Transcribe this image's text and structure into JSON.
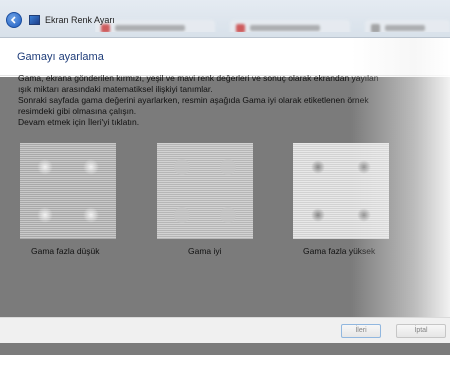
{
  "window": {
    "title": "Ekran Renk Ayarı"
  },
  "page": {
    "title": "Gamayı ayarlama",
    "paragraphs": [
      "Gama, ekrana gönderilen kırmızı, yeşil ve mavi renk değerleri ve sonuç olarak ekrandan yayılan",
      "ışık miktarı arasındaki matematiksel ilişkiyi tanımlar.",
      "Sonraki sayfada gama değerini ayarlarken, resmin aşağıda Gama iyi olarak etiketlenen örnek",
      "resimdeki gibi olmasına çalışın.",
      "Devam etmek için İleri'yi tıklatın."
    ]
  },
  "samples": [
    {
      "label": "Gama fazla düşük",
      "variant": "low"
    },
    {
      "label": "Gama iyi",
      "variant": "good"
    },
    {
      "label": "Gama fazla yüksek",
      "variant": "high"
    }
  ],
  "footer": {
    "next_label": "İleri",
    "cancel_label": "İptal"
  },
  "icons": {
    "back": "back-arrow-icon",
    "app": "display-color-icon"
  }
}
